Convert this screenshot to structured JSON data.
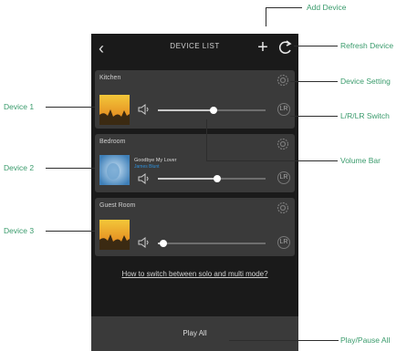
{
  "header": {
    "title": "DEVICE LIST",
    "back": "‹",
    "add": "+"
  },
  "devices": [
    {
      "name": "Kitchen",
      "volume": 0.52
    },
    {
      "name": "Bedroom",
      "volume": 0.55,
      "track_title": "Goodbye My Lover",
      "track_artist": "James Blunt"
    },
    {
      "name": "Guest Room",
      "volume": 0.05
    }
  ],
  "lr_label": "LR",
  "help_link": "How to switch between solo and multi mode?",
  "play_all": "Play All",
  "callouts": {
    "add_device": "Add Device",
    "refresh_device": "Refresh Device",
    "device_setting": "Device Setting",
    "lr_switch": "L/R/LR Switch",
    "volume_bar": "Volume Bar",
    "play_pause_all": "Play/Pause All",
    "device_1": "Device 1",
    "device_2": "Device 2",
    "device_3": "Device 3"
  },
  "colors": {
    "callout_text": "#3a9b6c",
    "phone_bg": "#1a1a1a",
    "card_bg": "#3a3a3a",
    "artist_accent": "#2f8fd8"
  }
}
